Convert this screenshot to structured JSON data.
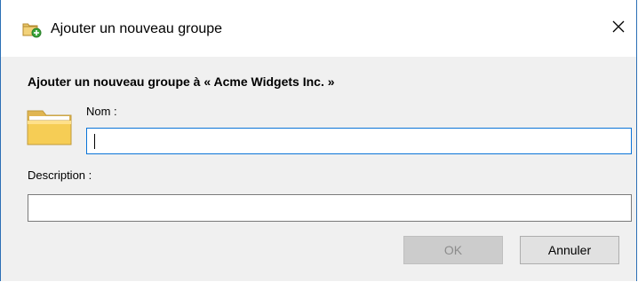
{
  "window": {
    "title": "Ajouter un nouveau groupe",
    "title_icon": "folder-add-icon",
    "close_icon": "close-icon"
  },
  "dialog": {
    "heading": "Ajouter un nouveau groupe à « Acme Widgets Inc. »",
    "folder_icon": "folder-icon",
    "name_label": "Nom :",
    "name_value": "",
    "description_label": "Description :",
    "description_value": ""
  },
  "buttons": {
    "ok_label": "OK",
    "ok_enabled": false,
    "cancel_label": "Annuler"
  },
  "colors": {
    "accent": "#0a74d8",
    "window_border": "#2b6fb5",
    "dialog_bg": "#f0f0f0"
  }
}
